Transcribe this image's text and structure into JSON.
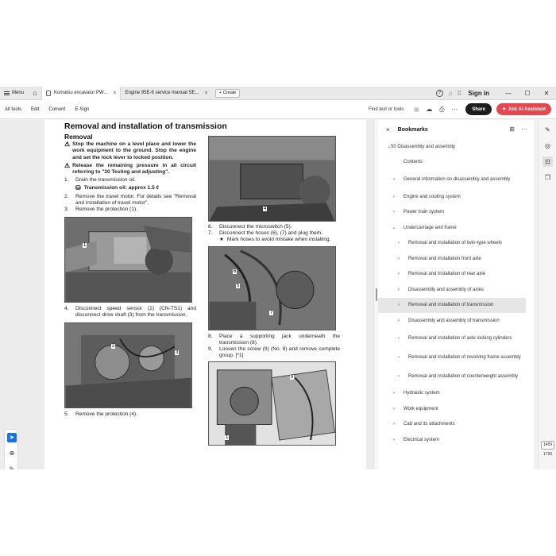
{
  "tabbar": {
    "menu_label": "Menu",
    "tabs": [
      {
        "label": "Komatsu excavator PW...",
        "active": true
      },
      {
        "label": "Engine 95E-6 service manual SE...",
        "active": false
      }
    ],
    "create_label": "Create",
    "signin_label": "Sign in"
  },
  "toolbar": {
    "links": [
      "All tools",
      "Edit",
      "Convert",
      "E-Sign"
    ],
    "find_label": "Find text or tools",
    "share_label": "Share",
    "ai_label": "Ask AI Assistant"
  },
  "document": {
    "page_title": "Removal and installation of transmission",
    "section_title": "Removal",
    "warnings": [
      "Stop the machine on a level place and lower the work equipment to the ground. Stop the engine and set the lock lever to locked position.",
      "Release the remaining pressure in all circuit referring to \"30 Testing and adjusting\"."
    ],
    "col1_steps": [
      {
        "n": "1.",
        "text": "Drain the transmission oil."
      },
      {
        "n": "2.",
        "text": "Remove the travel motor. For details see \"Removal and installation of travel motor\"."
      },
      {
        "n": "3.",
        "text": "Remove the protection (1)."
      },
      {
        "n": "4.",
        "text": "Disconnect speed sensor (2) (CN-TS1) and disconnect drive shaft (3) from the transmission."
      },
      {
        "n": "5.",
        "text": "Remove the protection (4)."
      }
    ],
    "oil_label": "Transmission oil: approx 1.5 ℓ",
    "col2_steps": [
      {
        "n": "6.",
        "text": "Disconnect the microswitch (5)."
      },
      {
        "n": "7.",
        "text": "Disconnect the hoses (6), (7) and plug them."
      },
      {
        "n": "8.",
        "text": "Place a supporting jack underneath the transmission (8)."
      },
      {
        "n": "9.",
        "text": "Loosen the screw (9) (No. 8) and remove complete group. [*1]"
      }
    ],
    "note_mark": "★",
    "note_text": "Mark hoses to avoid mistake when installing.",
    "callouts": {
      "p1": "1",
      "p2a": "2",
      "p2b": "3",
      "p3": "4",
      "p4": "5",
      "p5a": "6",
      "p5b": "7",
      "p6a": "9",
      "p6b": "1"
    }
  },
  "bookmarks": {
    "title": "Bookmarks",
    "items": [
      {
        "label": "50 Disassembly and assembly",
        "level": 0,
        "chevron": "down"
      },
      {
        "label": "Contents",
        "level": 1,
        "chevron": ""
      },
      {
        "label": "General information on disassembly and assembly",
        "level": 1,
        "chevron": "right"
      },
      {
        "label": "Engine and cooling system",
        "level": 1,
        "chevron": "right"
      },
      {
        "label": "Power train system",
        "level": 1,
        "chevron": "right"
      },
      {
        "label": "Undercarriage and frame",
        "level": 1,
        "chevron": "down"
      },
      {
        "label": "Removal and installation of twin-type wheels",
        "level": 2,
        "chevron": "right"
      },
      {
        "label": "Removal and installation front axle",
        "level": 2,
        "chevron": "right"
      },
      {
        "label": "Removal and installation of rear axle",
        "level": 2,
        "chevron": "right"
      },
      {
        "label": "Disassembly and assembly of axles",
        "level": 2,
        "chevron": "right"
      },
      {
        "label": "Removal and installation of transmission",
        "level": 2,
        "chevron": "right",
        "selected": true
      },
      {
        "label": "Disassembly and assembly of transmission",
        "level": 2,
        "chevron": "right"
      },
      {
        "label": "Removal and installation of axle locking cylinders",
        "level": 2,
        "chevron": "right"
      },
      {
        "label": "Removal and installation of revolving frame assembly",
        "level": 2,
        "chevron": "right"
      },
      {
        "label": "Removal and installation of counterweight assembly",
        "level": 2,
        "chevron": "right"
      },
      {
        "label": "Hydraulic system",
        "level": 1,
        "chevron": "right"
      },
      {
        "label": "Work equipment",
        "level": 1,
        "chevron": "right"
      },
      {
        "label": "Cab and its attachments",
        "level": 1,
        "chevron": "right"
      },
      {
        "label": "Electrical system",
        "level": 1,
        "chevron": "right"
      }
    ]
  },
  "rail": {
    "current_page": "1459",
    "total_pages": "1726"
  },
  "colors": {
    "accent": "#1473e6",
    "ai_button": "#e34850",
    "share_button": "#1d1d1d",
    "selected_bookmark": "#e6e6e6"
  }
}
